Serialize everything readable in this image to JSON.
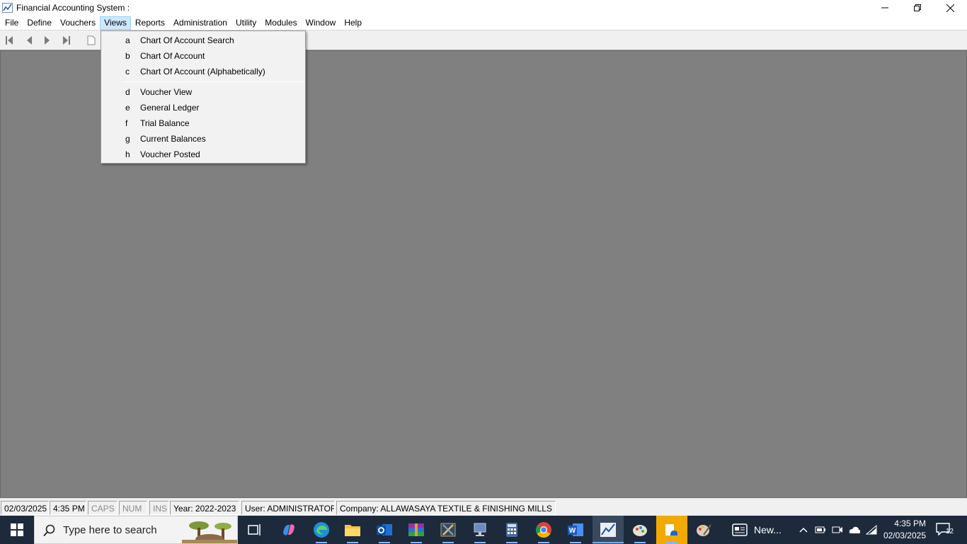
{
  "window": {
    "title": "Financial Accounting System :",
    "controls": [
      "minimize",
      "restore",
      "close"
    ]
  },
  "menubar": {
    "items": [
      {
        "label": "File"
      },
      {
        "label": "Define"
      },
      {
        "label": "Vouchers"
      },
      {
        "label": "Views",
        "active": true
      },
      {
        "label": "Reports"
      },
      {
        "label": "Administration"
      },
      {
        "label": "Utility"
      },
      {
        "label": "Modules"
      },
      {
        "label": "Window"
      },
      {
        "label": "Help"
      }
    ]
  },
  "toolbar": {
    "buttons": [
      "first-record-icon",
      "previous-record-icon",
      "next-record-icon",
      "last-record-icon",
      "new-document-icon"
    ]
  },
  "views_menu": {
    "items": [
      {
        "key": "a",
        "label": "Chart Of Account Search"
      },
      {
        "key": "b",
        "label": "Chart Of Account"
      },
      {
        "key": "c",
        "label": "Chart Of Account (Alphabetically)"
      },
      {
        "key": "d",
        "label": "Voucher View"
      },
      {
        "key": "e",
        "label": "General Ledger"
      },
      {
        "key": "f",
        "label": "Trial Balance"
      },
      {
        "key": "g",
        "label": "Current Balances"
      },
      {
        "key": "h",
        "label": "Voucher Posted"
      }
    ]
  },
  "statusbar": {
    "date": "02/03/2025",
    "time": "4:35 PM",
    "caps": "CAPS",
    "num": "NUM",
    "ins": "INS",
    "year": "Year: 2022-2023",
    "user": "User: ADMINISTRATOR",
    "company": "Company: ALLAWASAYA TEXTILE & FINISHING MILLS LTD."
  },
  "taskbar": {
    "search_placeholder": "Type here to search",
    "news_label": "New...",
    "clock_time": "4:35 PM",
    "clock_date": "02/03/2025",
    "notification_count": "12",
    "colors": {
      "background": "#1c2a3c",
      "accent": "#8ab4f8"
    }
  }
}
